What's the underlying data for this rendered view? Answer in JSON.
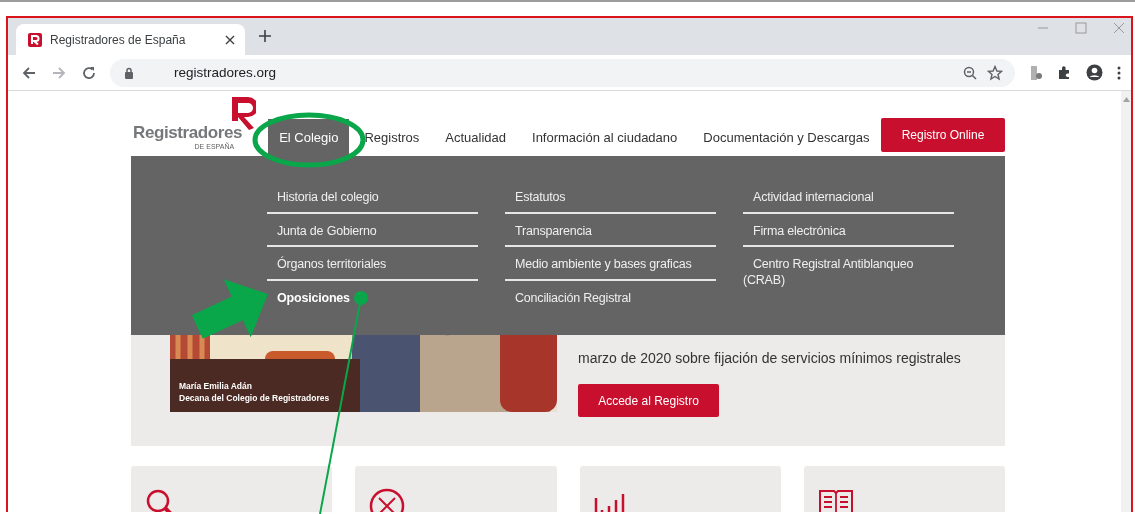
{
  "browser": {
    "tab": {
      "title": "Registradores de España"
    },
    "url": "registradores.org"
  },
  "header": {
    "logo": {
      "name": "Registradores",
      "sub": "DE ESPAÑA"
    },
    "nav": [
      {
        "label": "El Colegio",
        "selected": true
      },
      {
        "label": "Registros",
        "selected": false
      },
      {
        "label": "Actualidad",
        "selected": false
      },
      {
        "label": "Información al ciudadano",
        "selected": false
      },
      {
        "label": "Documentación y Descargas",
        "selected": false
      }
    ],
    "cta": "Registro Online"
  },
  "menu": {
    "columns": [
      {
        "items": [
          {
            "label": "Historia del colegio",
            "selected": false
          },
          {
            "label": "Junta de Gobierno",
            "selected": false
          },
          {
            "label": "Órganos territoriales",
            "selected": false
          },
          {
            "label": "Oposiciones",
            "selected": true
          }
        ]
      },
      {
        "items": [
          {
            "label": "Estatutos",
            "selected": false
          },
          {
            "label": "Transparencia",
            "selected": false
          },
          {
            "label": "Medio ambiente y bases graficas",
            "selected": false
          },
          {
            "label": "Conciliación Registral",
            "selected": false
          }
        ]
      },
      {
        "items": [
          {
            "label": "Actividad internacional",
            "selected": false
          },
          {
            "label": "Firma electrónica",
            "selected": false
          },
          {
            "label": "Centro Registral Antiblanqueo (CRAB)",
            "selected": false
          }
        ]
      }
    ]
  },
  "hero": {
    "caption": [
      "María Emilia Adán",
      "Decana del Colegio de Registradores"
    ],
    "text": "marzo de 2020 sobre fijación de servicios mínimos registrales",
    "button": "Accede al Registro"
  },
  "cards": [
    {
      "kind": "search"
    },
    {
      "kind": "blocked"
    },
    {
      "kind": "chart"
    },
    {
      "kind": "book"
    }
  ]
}
